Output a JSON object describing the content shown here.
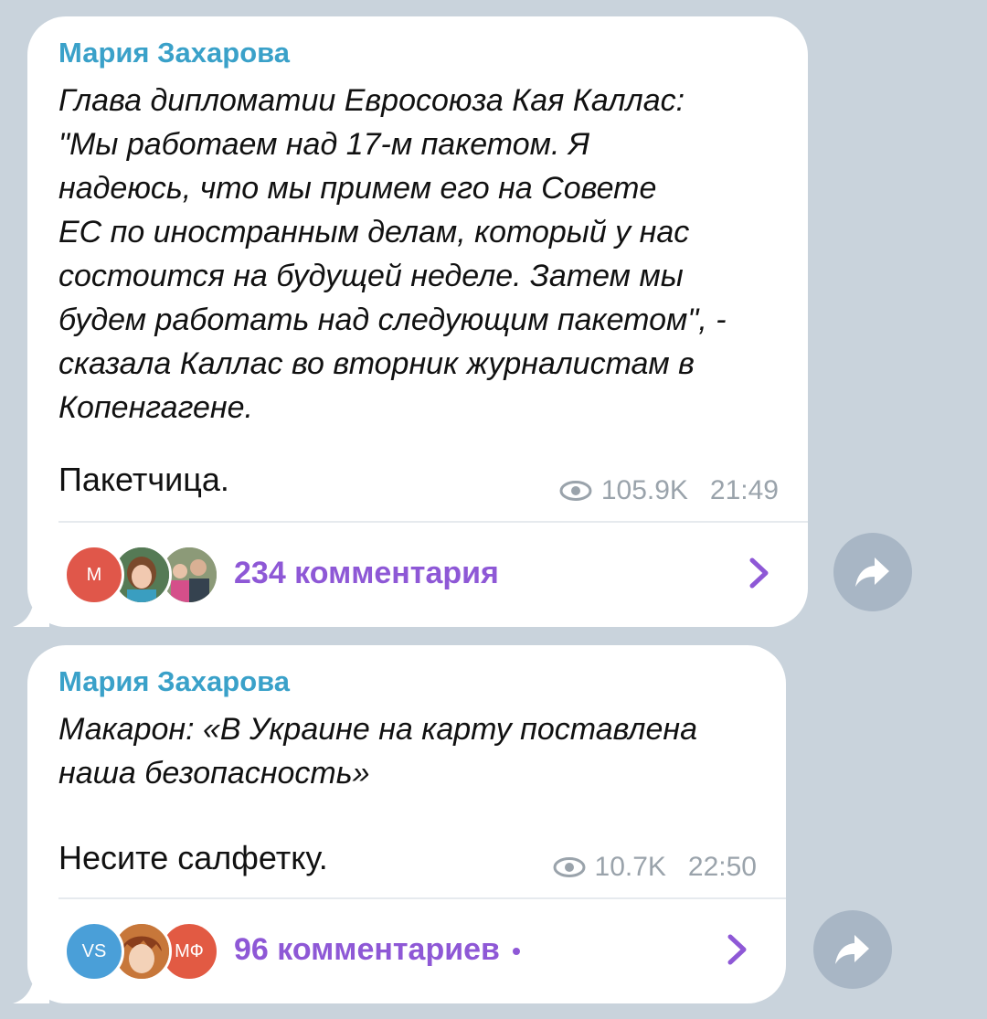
{
  "messages": [
    {
      "author": "Мария Захарова",
      "quote": "Глава дипломатии Евросоюза Кая Каллас:\n\"Мы работаем над 17-м пакетом. Я\nнадеюсь, что мы примем его на Совете\nЕС по иностранным делам, который у нас\nсостоится на будущей неделе. Затем мы\nбудем работать над следующим пакетом\", -\nсказала Каллас во вторник журналистам в\nКопенгагене.",
      "note": "Пакетчица.",
      "views": "105.9K",
      "time": "21:49",
      "comments_label": "234 комментария",
      "avatar_initial": "М"
    },
    {
      "author": "Мария Захарова",
      "quote": "Макарон: «В Украине на карту поставлена\nнаша безопасность»",
      "note": "Несите салфетку.",
      "views": "10.7K",
      "time": "22:50",
      "comments_label": "96 комментариев",
      "avatar_initials": [
        "VS",
        "МФ"
      ]
    }
  ],
  "colors": {
    "background": "#c9d3dc",
    "author": "#3aa1c9",
    "comments": "#8e58d6",
    "meta": "#9aa3ab",
    "share_button": "#a8b6c5"
  },
  "icons": {
    "views": "eye-icon",
    "open_comments": "chevron-right-icon",
    "share": "share-arrow-icon"
  }
}
